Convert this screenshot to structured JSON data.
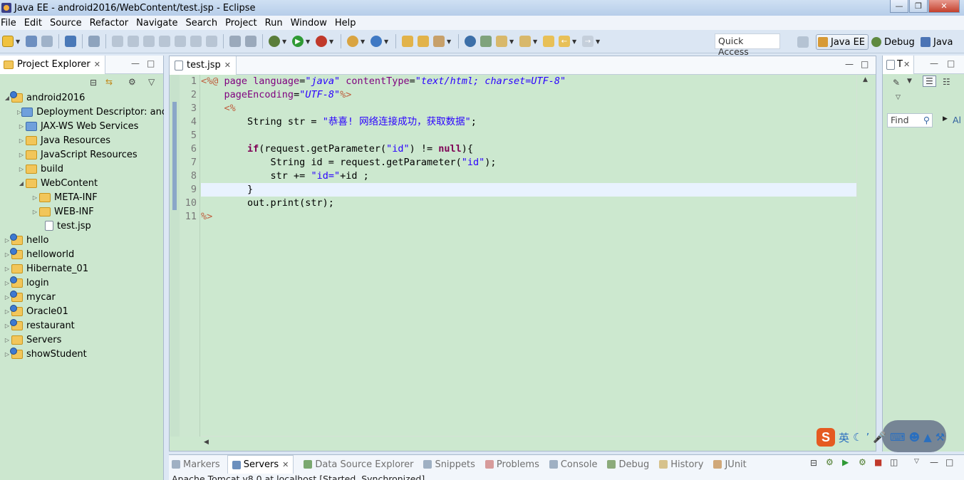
{
  "window": {
    "title": "Java EE - android2016/WebContent/test.jsp - Eclipse"
  },
  "menu": [
    "File",
    "Edit",
    "Source",
    "Refactor",
    "Navigate",
    "Search",
    "Project",
    "Run",
    "Window",
    "Help"
  ],
  "toolbar": {
    "quick_access_placeholder": "Quick Access",
    "perspectives": [
      {
        "label": "Java EE",
        "active": true
      },
      {
        "label": "Debug",
        "active": false
      },
      {
        "label": "Java",
        "active": false
      }
    ]
  },
  "project_explorer": {
    "title": "Project Explorer",
    "items": [
      {
        "label": "android2016",
        "level": 0,
        "expanded": true,
        "icon": "project-icon"
      },
      {
        "label": "Deployment Descriptor: andr",
        "level": 1,
        "expanded": false,
        "icon": "descriptor-icon"
      },
      {
        "label": "JAX-WS Web Services",
        "level": 1,
        "expanded": false,
        "icon": "webservices-icon"
      },
      {
        "label": "Java Resources",
        "level": 1,
        "expanded": false,
        "icon": "java-resources-icon"
      },
      {
        "label": "JavaScript Resources",
        "level": 1,
        "expanded": false,
        "icon": "javascript-resources-icon"
      },
      {
        "label": "build",
        "level": 1,
        "expanded": false,
        "icon": "folder-icon"
      },
      {
        "label": "WebContent",
        "level": 1,
        "expanded": true,
        "icon": "folder-icon"
      },
      {
        "label": "META-INF",
        "level": 2,
        "expanded": false,
        "icon": "folder-icon"
      },
      {
        "label": "WEB-INF",
        "level": 2,
        "expanded": false,
        "icon": "folder-icon"
      },
      {
        "label": "test.jsp",
        "level": 2,
        "expanded": null,
        "icon": "jsp-file-icon"
      },
      {
        "label": "hello",
        "level": 0,
        "expanded": false,
        "icon": "project-icon"
      },
      {
        "label": "helloworld",
        "level": 0,
        "expanded": false,
        "icon": "project-icon"
      },
      {
        "label": "Hibernate_01",
        "level": 0,
        "expanded": false,
        "icon": "folder-project-icon"
      },
      {
        "label": "login",
        "level": 0,
        "expanded": false,
        "icon": "project-icon"
      },
      {
        "label": "mycar",
        "level": 0,
        "expanded": false,
        "icon": "project-icon"
      },
      {
        "label": "Oracle01",
        "level": 0,
        "expanded": false,
        "icon": "project-icon"
      },
      {
        "label": "restaurant",
        "level": 0,
        "expanded": false,
        "icon": "project-icon"
      },
      {
        "label": "Servers",
        "level": 0,
        "expanded": false,
        "icon": "folder-project-icon"
      },
      {
        "label": "showStudent",
        "level": 0,
        "expanded": false,
        "icon": "project-icon"
      }
    ]
  },
  "editor": {
    "tab_label": "test.jsp",
    "line_numbers": [
      "1",
      "2",
      "3",
      "4",
      "5",
      "6",
      "7",
      "8",
      "9",
      "10",
      "11"
    ],
    "lines": [
      [
        [
          "tag",
          "<%@ "
        ],
        [
          "attr",
          "page "
        ],
        [
          "attr",
          "language"
        ],
        [
          "plain",
          "="
        ],
        [
          "val",
          "\"java\""
        ],
        [
          "plain",
          " "
        ],
        [
          "attr",
          "contentType"
        ],
        [
          "plain",
          "="
        ],
        [
          "val",
          "\"text/html; charset=UTF-8\""
        ]
      ],
      [
        [
          "plain",
          "    "
        ],
        [
          "attr",
          "pageEncoding"
        ],
        [
          "plain",
          "="
        ],
        [
          "val",
          "\"UTF-8\""
        ],
        [
          "tag",
          "%>"
        ]
      ],
      [
        [
          "plain",
          "    "
        ],
        [
          "tag",
          "<%"
        ]
      ],
      [
        [
          "plain",
          "        String str = "
        ],
        [
          "str",
          "\"恭喜! 网络连接成功，获取数据\""
        ],
        [
          "plain",
          ";"
        ]
      ],
      [
        [
          "plain",
          ""
        ]
      ],
      [
        [
          "plain",
          "        "
        ],
        [
          "kw",
          "if"
        ],
        [
          "plain",
          "(request.getParameter("
        ],
        [
          "str",
          "\"id\""
        ],
        [
          "plain",
          ") != "
        ],
        [
          "kw",
          "null"
        ],
        [
          "plain",
          "){"
        ]
      ],
      [
        [
          "plain",
          "            String id = request.getParameter("
        ],
        [
          "str",
          "\"id\""
        ],
        [
          "plain",
          ");"
        ]
      ],
      [
        [
          "plain",
          "            str += "
        ],
        [
          "str",
          "\"id=\""
        ],
        [
          "plain",
          "+id ;"
        ]
      ],
      [
        [
          "plain",
          "        }"
        ]
      ],
      [
        [
          "plain",
          "        out.print(str);"
        ]
      ],
      [
        [
          "tag",
          "%>"
        ]
      ]
    ],
    "current_line": 9
  },
  "right_panel": {
    "tab_label": "T",
    "find_placeholder": "Find",
    "all_label": "Al"
  },
  "bottom_panel": {
    "tabs": [
      {
        "label": "Markers",
        "active": false
      },
      {
        "label": "Servers",
        "active": true
      },
      {
        "label": "Data Source Explorer",
        "active": false
      },
      {
        "label": "Snippets",
        "active": false
      },
      {
        "label": "Problems",
        "active": false
      },
      {
        "label": "Console",
        "active": false
      },
      {
        "label": "Debug",
        "active": false
      },
      {
        "label": "History",
        "active": false
      },
      {
        "label": "JUnit",
        "active": false
      }
    ],
    "server_line": "Apache Tomcat v8.0 at localhost [Started, Synchronized]"
  },
  "ime_bar": {
    "lang": "英"
  }
}
